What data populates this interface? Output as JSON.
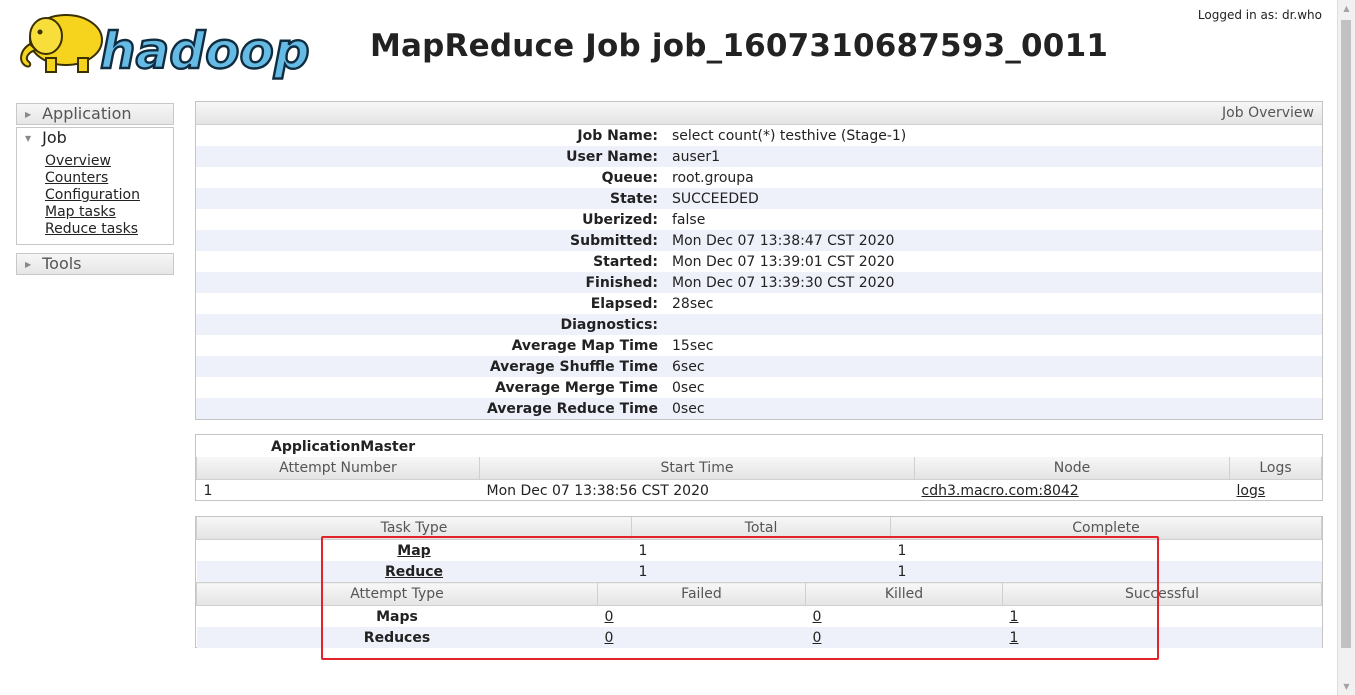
{
  "header": {
    "logo_text": "hadoop",
    "title": "MapReduce Job job_1607310687593_0011",
    "logged_in": "Logged in as: dr.who"
  },
  "nav": {
    "application": {
      "label": "Application"
    },
    "job": {
      "label": "Job",
      "items": [
        "Overview",
        "Counters",
        "Configuration",
        "Map tasks",
        "Reduce tasks"
      ]
    },
    "tools": {
      "label": "Tools"
    }
  },
  "overview": {
    "title": "Job Overview",
    "rows": [
      {
        "label": "Job Name:",
        "value": "select count(*) testhive (Stage-1)"
      },
      {
        "label": "User Name:",
        "value": "auser1"
      },
      {
        "label": "Queue:",
        "value": "root.groupa"
      },
      {
        "label": "State:",
        "value": "SUCCEEDED"
      },
      {
        "label": "Uberized:",
        "value": "false"
      },
      {
        "label": "Submitted:",
        "value": "Mon Dec 07 13:38:47 CST 2020"
      },
      {
        "label": "Started:",
        "value": "Mon Dec 07 13:39:01 CST 2020"
      },
      {
        "label": "Finished:",
        "value": "Mon Dec 07 13:39:30 CST 2020"
      },
      {
        "label": "Elapsed:",
        "value": "28sec"
      },
      {
        "label": "Diagnostics:",
        "value": ""
      },
      {
        "label": "Average Map Time",
        "value": "15sec"
      },
      {
        "label": "Average Shuffle Time",
        "value": "6sec"
      },
      {
        "label": "Average Merge Time",
        "value": "0sec"
      },
      {
        "label": "Average Reduce Time",
        "value": "0sec"
      }
    ]
  },
  "app_master": {
    "title": "ApplicationMaster",
    "columns": [
      "Attempt Number",
      "Start Time",
      "Node",
      "Logs"
    ],
    "row": {
      "attempt": "1",
      "start_time": "Mon Dec 07 13:38:56 CST 2020",
      "node": "cdh3.macro.com:8042",
      "logs": "logs"
    }
  },
  "tasks": {
    "columns": [
      "Task Type",
      "Total",
      "Complete"
    ],
    "rows": [
      {
        "type": "Map",
        "total": "1",
        "complete": "1"
      },
      {
        "type": "Reduce",
        "total": "1",
        "complete": "1"
      }
    ]
  },
  "attempts": {
    "columns": [
      "Attempt Type",
      "Failed",
      "Killed",
      "Successful"
    ],
    "rows": [
      {
        "type": "Maps",
        "failed": "0",
        "killed": "0",
        "successful": "1"
      },
      {
        "type": "Reduces",
        "failed": "0",
        "killed": "0",
        "successful": "1"
      }
    ]
  }
}
